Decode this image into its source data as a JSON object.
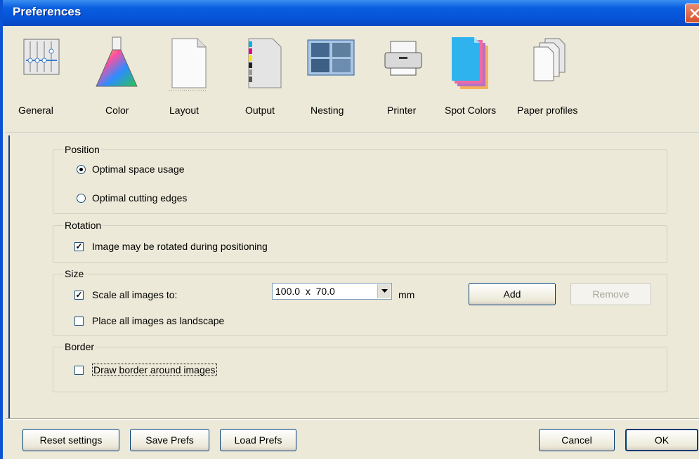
{
  "window": {
    "title": "Preferences"
  },
  "toolbar": {
    "items": [
      {
        "label": "General",
        "icon": "general-sliders-icon"
      },
      {
        "label": "Color",
        "icon": "color-flask-icon"
      },
      {
        "label": "Layout",
        "icon": "layout-page-icon"
      },
      {
        "label": "Output",
        "icon": "output-page-icon"
      },
      {
        "label": "Nesting",
        "icon": "nesting-icon"
      },
      {
        "label": "Printer",
        "icon": "printer-icon"
      },
      {
        "label": "Spot Colors",
        "icon": "spot-colors-icon"
      },
      {
        "label": "Paper profiles",
        "icon": "paper-profiles-icon"
      }
    ],
    "selected": "Nesting"
  },
  "position": {
    "legend": "Position",
    "optimal_space": "Optimal space usage",
    "optimal_cutting": "Optimal cutting edges",
    "selected": "Optimal space usage"
  },
  "rotation": {
    "legend": "Rotation",
    "rotate_label": "Image may be rotated during positioning",
    "rotate_checked": true
  },
  "size": {
    "legend": "Size",
    "scale_label": "Scale all images to:",
    "scale_checked": true,
    "scale_value": "100.0  x  70.0",
    "unit": "mm",
    "add_label": "Add",
    "remove_label": "Remove",
    "landscape_label": "Place all images as landscape",
    "landscape_checked": false
  },
  "border": {
    "legend": "Border",
    "draw_label": "Draw border around images",
    "draw_checked": false
  },
  "footer": {
    "reset_label": "Reset settings",
    "save_label": "Save Prefs",
    "load_label": "Load Prefs",
    "cancel_label": "Cancel",
    "ok_label": "OK"
  },
  "colors": {
    "titlebar": "#0553d8",
    "dialog_bg": "#ece9d8",
    "close_button": "#d5502d"
  }
}
